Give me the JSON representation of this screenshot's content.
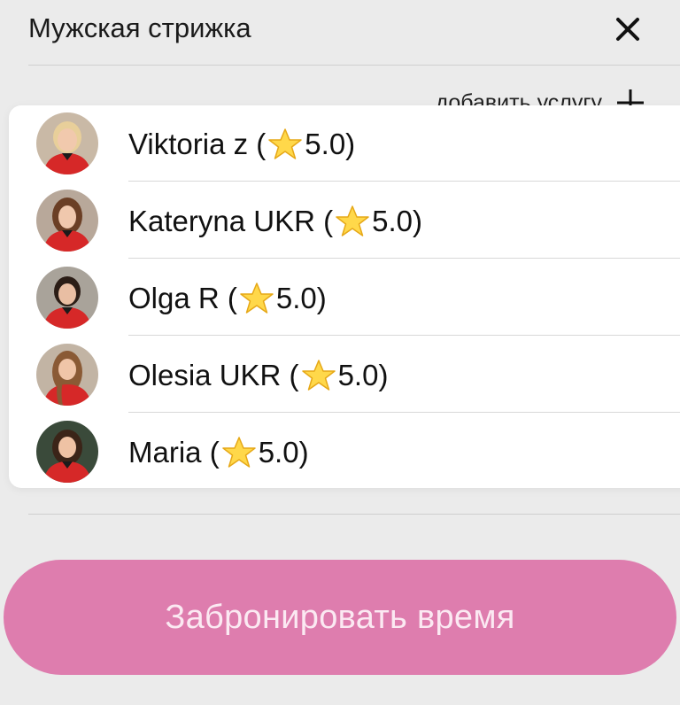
{
  "header": {
    "title": "Мужская стрижка"
  },
  "add_service": {
    "label": "добавить услугу"
  },
  "masters": [
    {
      "name": "Viktoria z",
      "rating": "5.0"
    },
    {
      "name": "Kateryna UKR",
      "rating": "5.0"
    },
    {
      "name": "Olga R",
      "rating": "5.0"
    },
    {
      "name": "Olesia UKR",
      "rating": "5.0"
    },
    {
      "name": "Maria",
      "rating": "5.0"
    }
  ],
  "book_button": {
    "label": "Забронировать время"
  },
  "icons": {
    "close": "close-icon",
    "plus": "plus-icon",
    "star": "star-icon"
  },
  "colors": {
    "background": "#ebebeb",
    "book_button": "#de7dae",
    "star_fill": "#ffd84a",
    "uniform_red": "#d62828"
  }
}
